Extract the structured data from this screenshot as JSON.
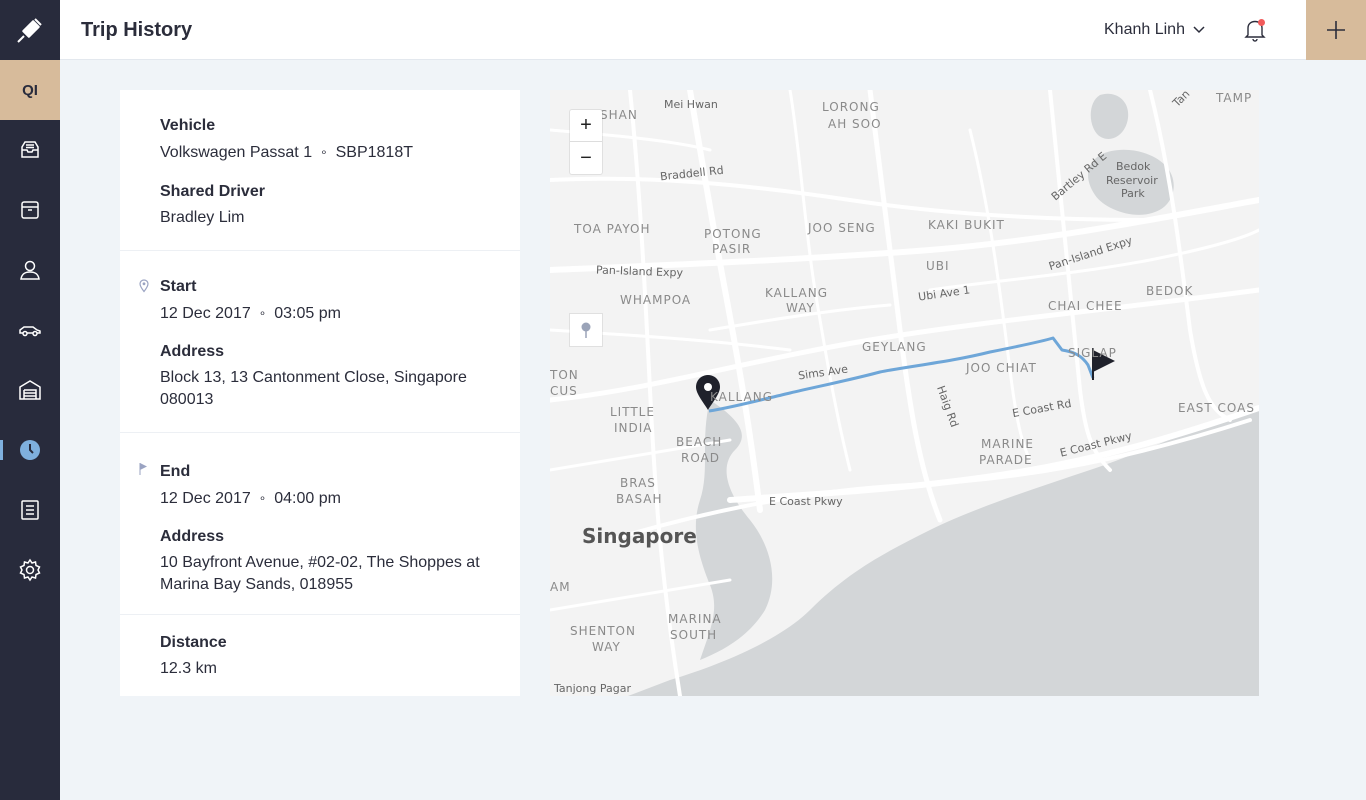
{
  "app": {
    "org_initials": "QI"
  },
  "header": {
    "title": "Trip History",
    "user_name": "Khanh Linh"
  },
  "sidebar": {
    "items": [
      {
        "name": "inbox-icon"
      },
      {
        "name": "box-icon"
      },
      {
        "name": "user-icon"
      },
      {
        "name": "car-icon"
      },
      {
        "name": "garage-icon"
      },
      {
        "name": "clock-icon",
        "active": true
      },
      {
        "name": "document-icon"
      },
      {
        "name": "gear-icon"
      }
    ]
  },
  "trip": {
    "vehicle_label": "Vehicle",
    "vehicle_model": "Volkswagen Passat 1",
    "vehicle_plate": "SBP1818T",
    "driver_label": "Shared Driver",
    "driver_name": "Bradley Lim",
    "start_label": "Start",
    "start_date": "12 Dec 2017",
    "start_time": "03:05 pm",
    "start_address_label": "Address",
    "start_address_line1": "Block 13, 13 Cantonment Close, Singapore",
    "start_address_line2": "080013",
    "end_label": "End",
    "end_date": "12 Dec 2017",
    "end_time": "04:00 pm",
    "end_address_label": "Address",
    "end_address_line1": "10 Bayfront Avenue, #02-02, The Shoppes at",
    "end_address_line2": "Marina Bay Sands, 018955",
    "distance_label": "Distance",
    "distance_value": "12.3 km"
  },
  "map": {
    "zoom_in": "+",
    "zoom_out": "−",
    "route_color": "#6ea6d8",
    "labels": {
      "mei_hwan": "Mei Hwan",
      "lorong": "LORONG",
      "ah_soo": "AH SOO",
      "shan": "SHAN",
      "braddell": "Braddell Rd",
      "bartley": "Bartley Rd E",
      "bedok_res_1": "Bedok",
      "bedok_res_2": "Reservoir",
      "bedok_res_3": "Park",
      "tamp": "TAMP",
      "tan": "Tan",
      "toa_payoh": "TOA PAYOH",
      "potong": "POTONG",
      "pasir": "PASIR",
      "joo_seng": "JOO SENG",
      "kaki_bukit": "KAKI BUKIT",
      "pan_island_w": "Pan-Island Expy",
      "pan_island_e": "Pan-Island Expy",
      "ubi": "UBI",
      "ubi_ave": "Ubi Ave 1",
      "whampoa": "WHAMPOA",
      "kallang": "KALLANG",
      "way": "WAY",
      "chai_chee": "CHAI CHEE",
      "bedok": "BEDOK",
      "geylang": "GEYLANG",
      "sims_ave": "Sims Ave",
      "joo_chiat": "JOO CHIAT",
      "siglap": "SIGLAP",
      "ton": "TON",
      "cus": "CUS",
      "kallang2": "KALLANG",
      "haig": "Haig Rd",
      "e_coast_rd": "E Coast Rd",
      "east_coast": "EAST COAS",
      "little": "LITTLE",
      "india": "INDIA",
      "beach": "BEACH",
      "road": "ROAD",
      "marine": "MARINE",
      "parade": "PARADE",
      "e_coast_pkwy_1": "E Coast Pkwy",
      "bras": "BRAS",
      "basah": "BASAH",
      "e_coast_pkwy_2": "E Coast Pkwy",
      "singapore": "Singapore",
      "am": "AM",
      "shenton": "SHENTON",
      "shenton_way": "WAY",
      "marina": "MARINA",
      "south": "SOUTH",
      "tanjong": "Tanjong Pagar"
    }
  }
}
